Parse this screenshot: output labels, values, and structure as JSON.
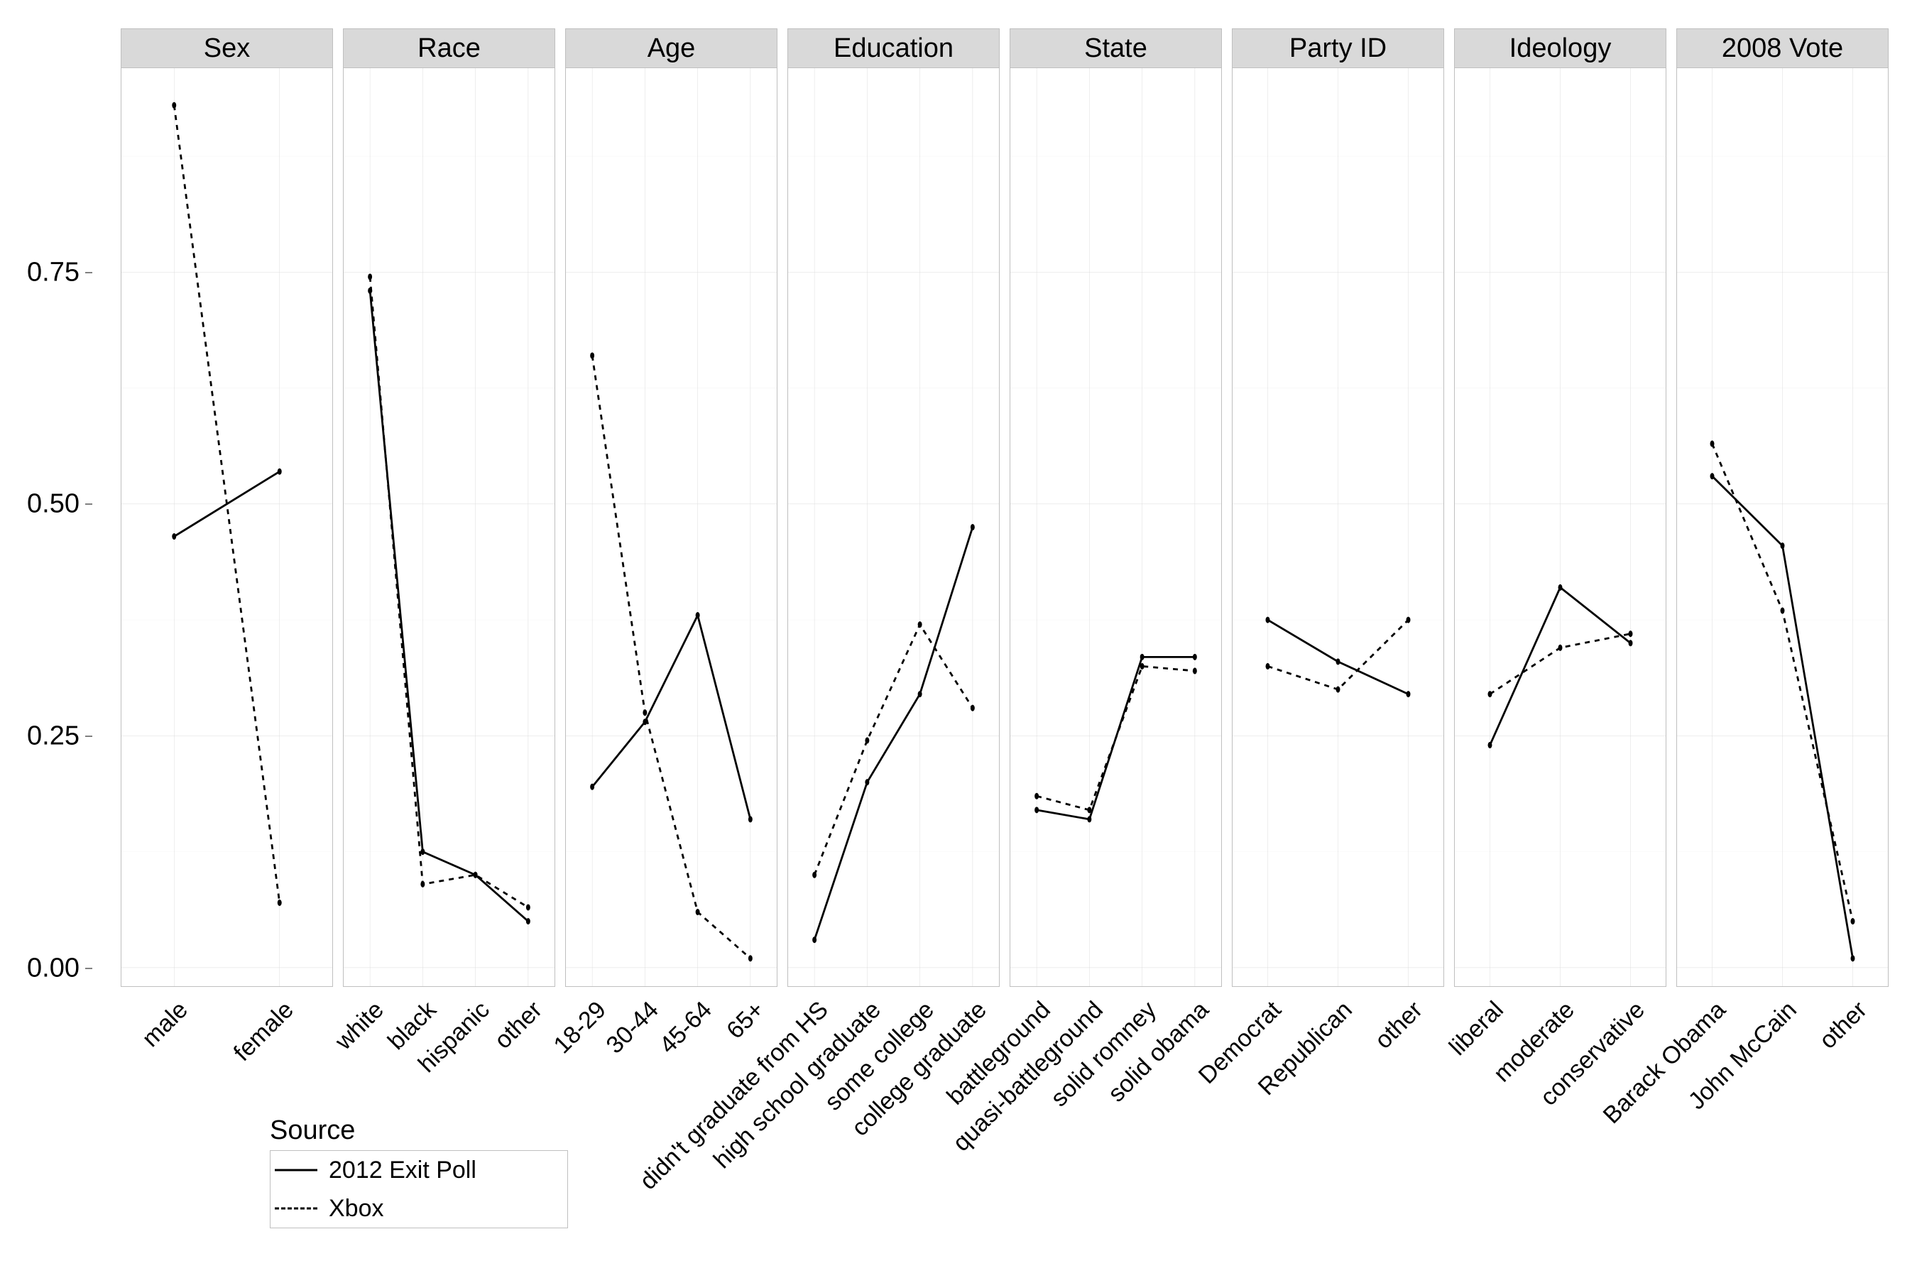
{
  "chart_data": {
    "type": "line",
    "ylim": [
      -0.02,
      0.97
    ],
    "y_ticks": [
      0.0,
      0.25,
      0.5,
      0.75
    ],
    "y_tick_labels": [
      "0.00",
      "0.25",
      "0.50",
      "0.75"
    ],
    "series_meta": [
      {
        "name": "2012 Exit Poll",
        "key": "exit",
        "dash": "solid"
      },
      {
        "name": "Xbox",
        "key": "xbox",
        "dash": "dashed"
      }
    ],
    "panels": [
      {
        "title": "Sex",
        "categories": [
          "male",
          "female"
        ],
        "series": {
          "exit": [
            0.465,
            0.535
          ],
          "xbox": [
            0.93,
            0.07
          ]
        }
      },
      {
        "title": "Race",
        "categories": [
          "white",
          "black",
          "hispanic",
          "other"
        ],
        "series": {
          "exit": [
            0.73,
            0.125,
            0.1,
            0.05
          ],
          "xbox": [
            0.745,
            0.09,
            0.1,
            0.065
          ]
        }
      },
      {
        "title": "Age",
        "categories": [
          "18-29",
          "30-44",
          "45-64",
          "65+"
        ],
        "series": {
          "exit": [
            0.195,
            0.265,
            0.38,
            0.16
          ],
          "xbox": [
            0.66,
            0.275,
            0.06,
            0.01
          ]
        }
      },
      {
        "title": "Education",
        "categories": [
          "didn't graduate from HS",
          "high school graduate",
          "some college",
          "college graduate"
        ],
        "series": {
          "exit": [
            0.03,
            0.2,
            0.295,
            0.475
          ],
          "xbox": [
            0.1,
            0.245,
            0.37,
            0.28
          ]
        }
      },
      {
        "title": "State",
        "categories": [
          "battleground",
          "quasi-battleground",
          "solid romney",
          "solid obama"
        ],
        "series": {
          "exit": [
            0.17,
            0.16,
            0.335,
            0.335
          ],
          "xbox": [
            0.185,
            0.17,
            0.325,
            0.32
          ]
        }
      },
      {
        "title": "Party ID",
        "categories": [
          "Democrat",
          "Republican",
          "other"
        ],
        "series": {
          "exit": [
            0.375,
            0.33,
            0.295
          ],
          "xbox": [
            0.325,
            0.3,
            0.375
          ]
        }
      },
      {
        "title": "Ideology",
        "categories": [
          "liberal",
          "moderate",
          "conservative"
        ],
        "series": {
          "exit": [
            0.24,
            0.41,
            0.35
          ],
          "xbox": [
            0.295,
            0.345,
            0.36
          ]
        }
      },
      {
        "title": "2008 Vote",
        "categories": [
          "Barack Obama",
          "John McCain",
          "other"
        ],
        "series": {
          "exit": [
            0.53,
            0.455,
            0.01
          ],
          "xbox": [
            0.565,
            0.385,
            0.05
          ]
        }
      }
    ],
    "legend": {
      "title": "Source",
      "items": [
        {
          "label": "2012 Exit Poll",
          "dash": "solid"
        },
        {
          "label": "Xbox",
          "dash": "dashed"
        }
      ]
    }
  }
}
